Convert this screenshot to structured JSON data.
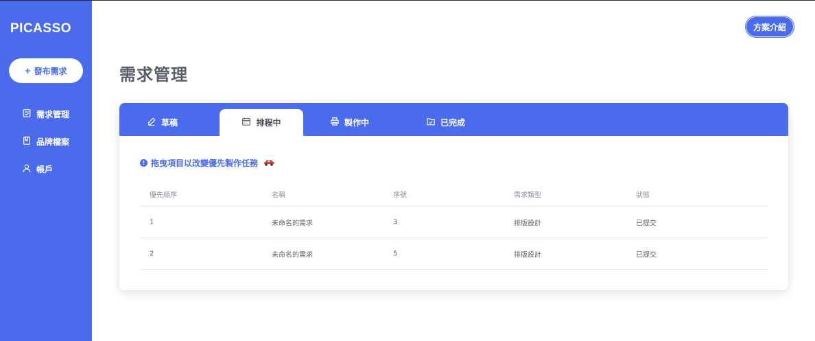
{
  "sidebar": {
    "logo": "PICASSO",
    "publish_button": "發布需求",
    "items": [
      {
        "label": "需求管理",
        "icon": "clipboard-icon"
      },
      {
        "label": "品牌檔案",
        "icon": "book-icon"
      },
      {
        "label": "帳戶",
        "icon": "user-icon"
      }
    ]
  },
  "header": {
    "intro_button": "方案介紹"
  },
  "main": {
    "title": "需求管理",
    "tabs": [
      {
        "label": "草稿",
        "icon": "pencil-icon",
        "active": false
      },
      {
        "label": "排程中",
        "icon": "calendar-icon",
        "active": true
      },
      {
        "label": "製作中",
        "icon": "printer-icon",
        "active": false
      },
      {
        "label": "已完成",
        "icon": "folder-check-icon",
        "active": false
      }
    ],
    "hint": "拖曳項目以改變優先製作任務",
    "table": {
      "columns": [
        "優先順序",
        "名稱",
        "序號",
        "需求類型",
        "狀態"
      ],
      "rows": [
        [
          "1",
          "未命名的需求",
          "3",
          "排版設計",
          "已提交"
        ],
        [
          "2",
          "未命名的需求",
          "5",
          "排版設計",
          "已提交"
        ]
      ]
    }
  },
  "colors": {
    "accent": "#4a6cec",
    "title": "#5b5f6b",
    "text": "#5c606b"
  }
}
